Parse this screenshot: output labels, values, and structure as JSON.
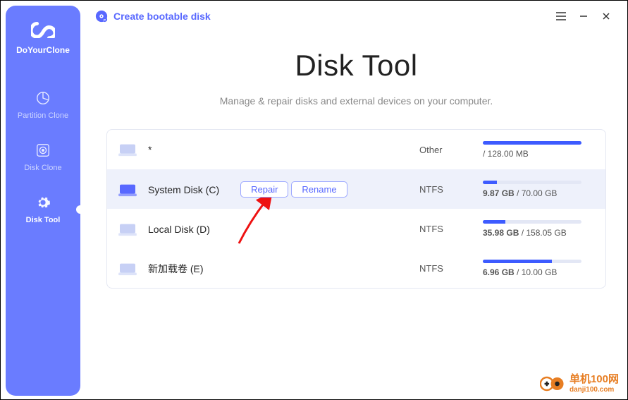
{
  "brand": "DoYourClone",
  "sidebar": {
    "items": [
      {
        "label": "Partition Clone"
      },
      {
        "label": "Disk Clone"
      },
      {
        "label": "Disk Tool"
      }
    ]
  },
  "topbar": {
    "create_bootable": "Create bootable disk"
  },
  "main": {
    "title": "Disk Tool",
    "subtitle": "Manage & repair disks and external devices on your computer."
  },
  "actions": {
    "repair": "Repair",
    "rename": "Rename"
  },
  "disks": [
    {
      "name": "*",
      "fs": "Other",
      "used": "",
      "total": "128.00 MB",
      "pct": 100
    },
    {
      "name": "System Disk (C)",
      "fs": "NTFS",
      "used": "9.87 GB",
      "total": "70.00 GB",
      "pct": 14,
      "hovered": true
    },
    {
      "name": "Local Disk (D)",
      "fs": "NTFS",
      "used": "35.98 GB",
      "total": "158.05 GB",
      "pct": 23
    },
    {
      "name": "新加载卷 (E)",
      "fs": "NTFS",
      "used": "6.96 GB",
      "total": "10.00 GB",
      "pct": 70
    }
  ],
  "watermark": {
    "cn": "单机100网",
    "en": "danji100.com"
  }
}
